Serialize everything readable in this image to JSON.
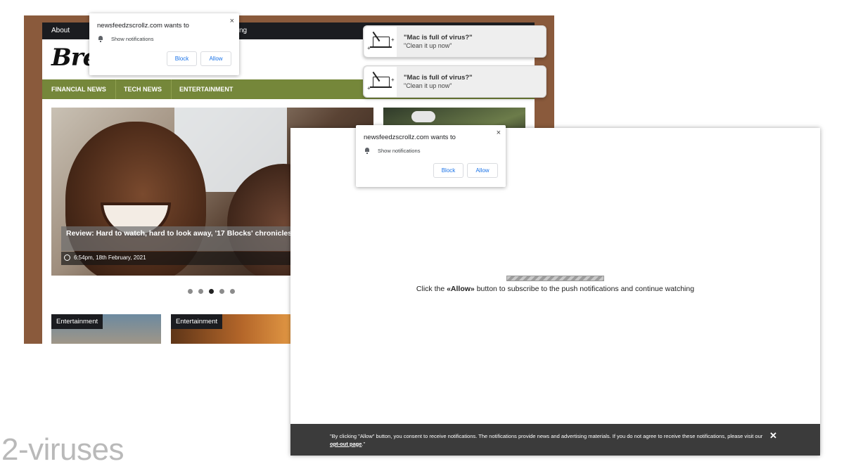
{
  "site": {
    "topnav_about": "About",
    "topnav_partial_a": "",
    "topnav_partial_b": "ng",
    "logo_text": "Bre",
    "nav": [
      "FINANCIAL NEWS",
      "TECH NEWS",
      "ENTERTAINMENT"
    ],
    "hero_caption": "Review: Hard to watch, hard to look away, '17 Blocks' chronicles a D struggles",
    "hero_date": "6:54pm, 18th February, 2021",
    "carousel": {
      "count": 5,
      "active_index": 2
    },
    "cards": [
      {
        "tag": "Entertainment"
      },
      {
        "tag": "Entertainment"
      }
    ]
  },
  "permission_prompt": {
    "site_text": "newsfeedzscrollz.com wants to",
    "permission": "Show notifications",
    "block_label": "Block",
    "allow_label": "Allow",
    "close_symbol": "×"
  },
  "toasts": [
    {
      "title": "\"Mac is full of virus?\"",
      "body": "\"Clean it up now\""
    },
    {
      "title": "\"Mac is full of virus?\"",
      "body": "\"Clean it up now\""
    }
  ],
  "landing": {
    "instruction_prefix": "Click the ",
    "instruction_bold": "«Allow»",
    "instruction_suffix": " button to subscribe to the push notifications and continue watching",
    "consent_text": "\"By clicking \"Allow\" button, you consent to receive notifications. The notifications provide news and advertising materials. If you do not agree to receive these notifications, please visit our ",
    "consent_link": "opt-out page",
    "consent_end": ".\"",
    "close_symbol": "✕"
  },
  "watermark": "2-viruses",
  "colors": {
    "frame_brown": "#8a5a3c",
    "nav_green": "#75873a",
    "topbar_dark": "#1b1c20",
    "link_blue": "#1a73e8",
    "consent_bar": "#3b3b3b"
  },
  "icons": [
    "bell-icon",
    "close-icon",
    "clock-icon",
    "laptop-broom-icon"
  ]
}
